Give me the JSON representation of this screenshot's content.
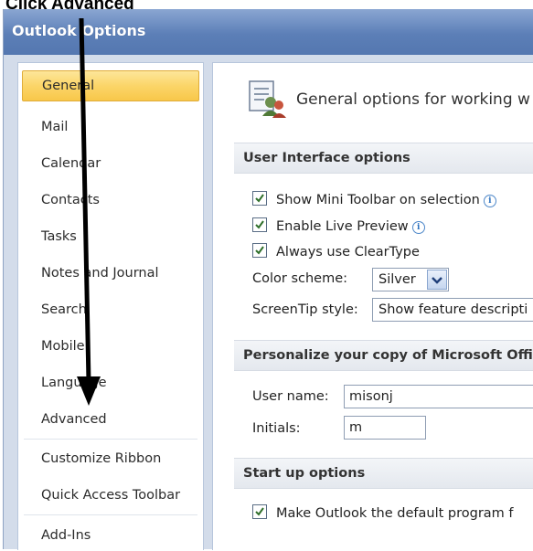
{
  "instruction": "Click Advanced",
  "window": {
    "title": "Outlook Options"
  },
  "sidebar": {
    "items": [
      {
        "label": "General",
        "selected": true
      },
      {
        "label": "Mail"
      },
      {
        "label": "Calendar"
      },
      {
        "label": "Contacts"
      },
      {
        "label": "Tasks"
      },
      {
        "label": "Notes and Journal"
      },
      {
        "label": "Search"
      },
      {
        "label": "Mobile"
      },
      {
        "label": "Language"
      },
      {
        "label": "Advanced"
      },
      {
        "label": "Customize Ribbon"
      },
      {
        "label": "Quick Access Toolbar"
      },
      {
        "label": "Add-Ins"
      }
    ]
  },
  "content": {
    "header": "General options for working w",
    "ui_options": {
      "title": "User Interface options",
      "show_mini_toolbar": "Show Mini Toolbar on selection",
      "enable_live_preview": "Enable Live Preview",
      "always_cleartype": "Always use ClearType",
      "color_scheme_label": "Color scheme:",
      "color_scheme_value": "Silver",
      "screentip_label": "ScreenTip style:",
      "screentip_value": "Show feature descripti"
    },
    "personalize": {
      "title": "Personalize your copy of Microsoft Office",
      "username_label": "User name:",
      "username_value": "misonj",
      "initials_label": "Initials:",
      "initials_value": "m"
    },
    "startup": {
      "title": "Start up options",
      "default_program": "Make Outlook the default program f"
    }
  },
  "colors": {
    "title_bar": "#5c7fb7",
    "selected_item": "#fbd568",
    "arrow": "#000000"
  }
}
